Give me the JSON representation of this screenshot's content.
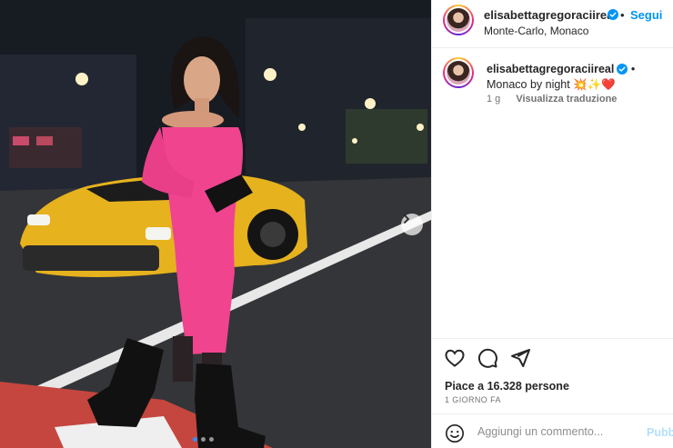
{
  "post": {
    "username": "elisabettagregoraciireal",
    "follow_label": "Segui",
    "location": "Monte-Carlo, Monaco",
    "caption_text": "Monaco by night",
    "caption_emojis": "💥✨❤️",
    "age": "1 g",
    "translate_label": "Visualizza traduzione",
    "likes": "Piace a 16.328 persone",
    "posted": "1 GIORNO FA",
    "comment_placeholder": "Aggiungi un commento...",
    "publish_label": "Pubb"
  },
  "carousel": {
    "slides": 3,
    "active_index": 0
  },
  "colors": {
    "accent": "#0095f6",
    "dress": "#f0448f",
    "car": "#e6b21e"
  },
  "icons": {
    "verified": "verified-badge-icon",
    "next": "chevron-right-icon",
    "like": "heart-icon",
    "comment": "comment-icon",
    "share": "share-icon",
    "emoji": "emoji-icon"
  }
}
